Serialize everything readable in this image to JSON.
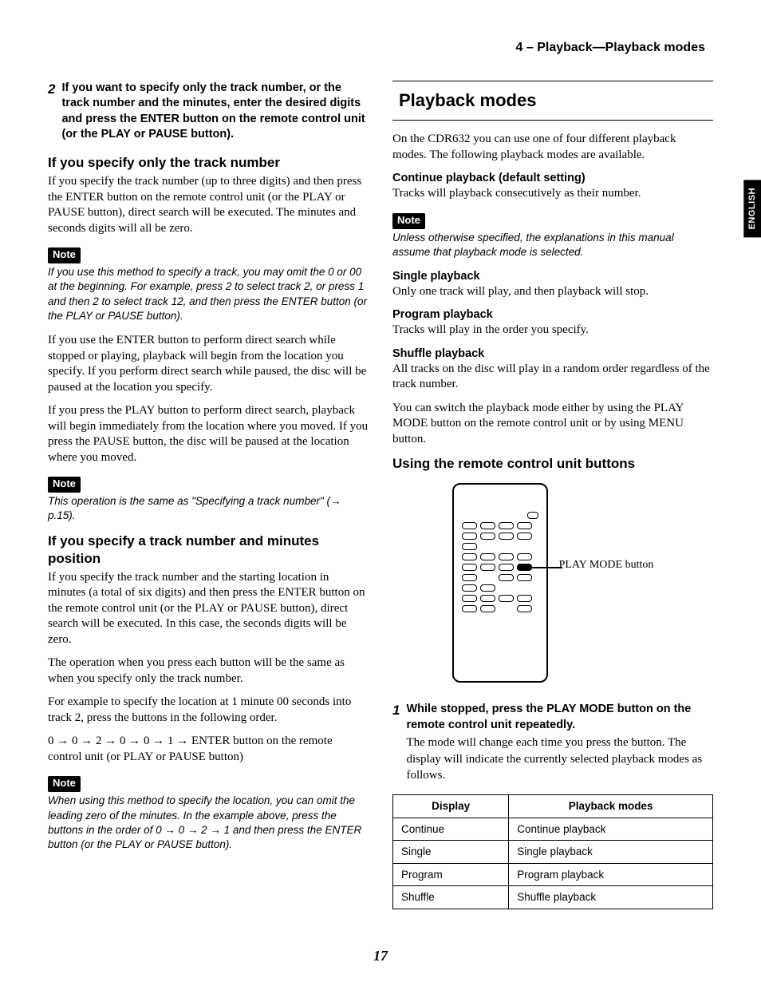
{
  "header": "4 – Playback—Playback modes",
  "left": {
    "step2": "If you want to specify only the track number, or the track number and the minutes, enter the desired digits and press the ENTER button on the remote control unit (or the PLAY or PAUSE button).",
    "h_tracknum": "If you specify only the track number",
    "p_tracknum": "If you specify the track number (up to three digits) and then press the ENTER button on the remote control unit (or the PLAY or PAUSE button), direct search will be executed. The minutes and seconds digits will all be zero.",
    "note1_tag": "Note",
    "note1_body": "If you use this method to specify a track, you may omit the 0 or 00 at the beginning. For example, press 2 to select track 2, or press 1 and then 2 to select track 12, and then press the ENTER button (or the PLAY or PAUSE button).",
    "p_enter": "If you use the ENTER button to perform direct search while stopped or playing, playback will begin from the location you specify. If you perform direct search while paused, the disc will be paused at the location you specify.",
    "p_play": "If you press the PLAY button to perform direct search, playback will begin immediately from the location where you moved. If you press the PAUSE button, the disc will be paused at the location where you moved.",
    "note2_tag": "Note",
    "note2_body": "This operation is the same as \"Specifying a track number\" (→ p.15).",
    "h_minpos": "If you specify a track number and minutes position",
    "p_minpos1": "If you specify the track number and the starting location in minutes (a total of six digits) and then press the ENTER button on the remote control unit (or the PLAY or PAUSE button), direct search will be executed. In this case, the seconds digits will be zero.",
    "p_minpos2": "The operation when you press each button will be the same as when you specify only the track number.",
    "p_minpos3": "For example to specify the location at 1 minute 00 seconds into track 2, press the buttons in the following order.",
    "p_minpos4": "0 → 0 → 2 → 0 → 0 → 1 → ENTER button on the remote control unit (or PLAY or PAUSE button)",
    "note3_tag": "Note",
    "note3_body": "When using this method to specify the location, you can omit the leading zero of the minutes. In the example above, press the buttons in the order of 0 → 0 → 2 → 1 and then press the ENTER button (or the PLAY or PAUSE button)."
  },
  "right": {
    "h_modes": "Playback modes",
    "p_intro": "On the CDR632 you can use one of four different playback modes. The following playback modes are available.",
    "h_cont": "Continue playback (default setting)",
    "p_cont": "Tracks will playback consecutively as their number.",
    "note_tag": "Note",
    "note_body": "Unless otherwise specified, the explanations in this manual assume that playback mode is selected.",
    "h_single": "Single playback",
    "p_single": "Only one track will play, and then playback will stop.",
    "h_program": "Program playback",
    "p_program": "Tracks will play in the order you specify.",
    "h_shuffle": "Shuffle playback",
    "p_shuffle1": "All tracks on the disc will play in a random order regardless of the track number.",
    "p_shuffle2": "You can switch the playback mode either by using the PLAY MODE button on the remote control unit or by using MENU button.",
    "h_remote": "Using the remote control unit buttons",
    "callout": "PLAY MODE button",
    "step1_bold": "While stopped, press the PLAY MODE button on the remote control unit repeatedly.",
    "step1_body": "The mode will change each time you press the button. The display will indicate the currently selected playback modes as follows.",
    "table": {
      "h1": "Display",
      "h2": "Playback modes",
      "rows": [
        {
          "d": "Continue",
          "m": "Continue playback"
        },
        {
          "d": "Single",
          "m": "Single playback"
        },
        {
          "d": "Program",
          "m": "Program playback"
        },
        {
          "d": "Shuffle",
          "m": "Shuffle playback"
        }
      ]
    }
  },
  "lang": "ENGLISH",
  "page": "17"
}
